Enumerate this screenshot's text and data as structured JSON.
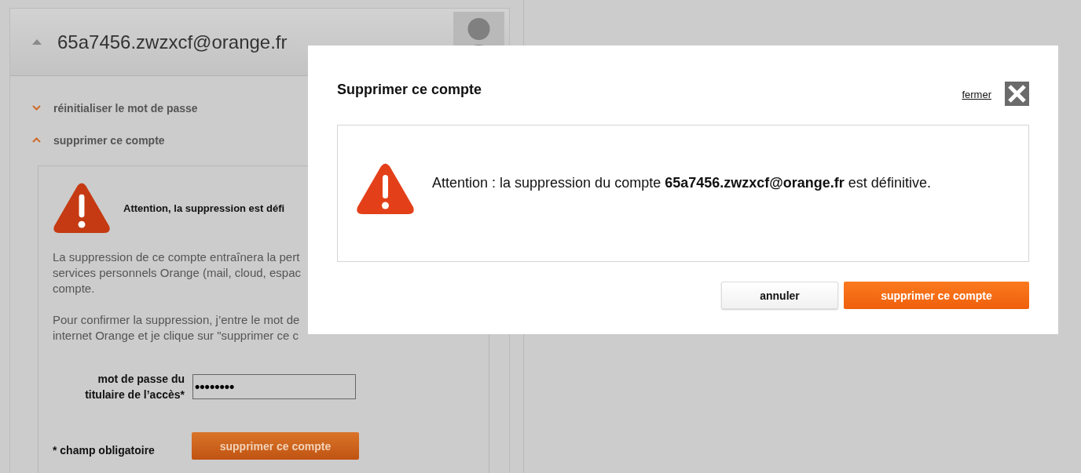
{
  "account": {
    "email": "65a7456.zwzxcf@orange.fr",
    "expanded": true
  },
  "menu": [
    {
      "label": "réinitialiser le mot de passe",
      "expanded": false
    },
    {
      "label": "supprimer ce compte",
      "expanded": true
    }
  ],
  "delete_panel": {
    "warning": "Attention, la suppression est défi",
    "paragraphs": [
      [
        "La suppression de ce compte entraînera la pert",
        "services personnels Orange (mail, cloud, espac",
        "compte."
      ],
      [
        "Pour confirmer la suppression, j’entre le mot de",
        "internet Orange et je clique sur \"supprimer ce c"
      ]
    ],
    "password_label": "mot de passe du titulaire de l’accès*",
    "password_value": "••••••••",
    "required_note": "* champ obligatoire",
    "submit": "supprimer ce compte"
  },
  "dialog": {
    "title": "Supprimer ce compte",
    "close_link": "fermer",
    "message": "Attention : la suppression du compte **65a7456.zwzxcf@orange.fr** est définitive.",
    "buttons": [
      {
        "label": "annuler",
        "kind": "secondary"
      },
      {
        "label": "supprimer ce compte",
        "kind": "primary"
      }
    ]
  }
}
